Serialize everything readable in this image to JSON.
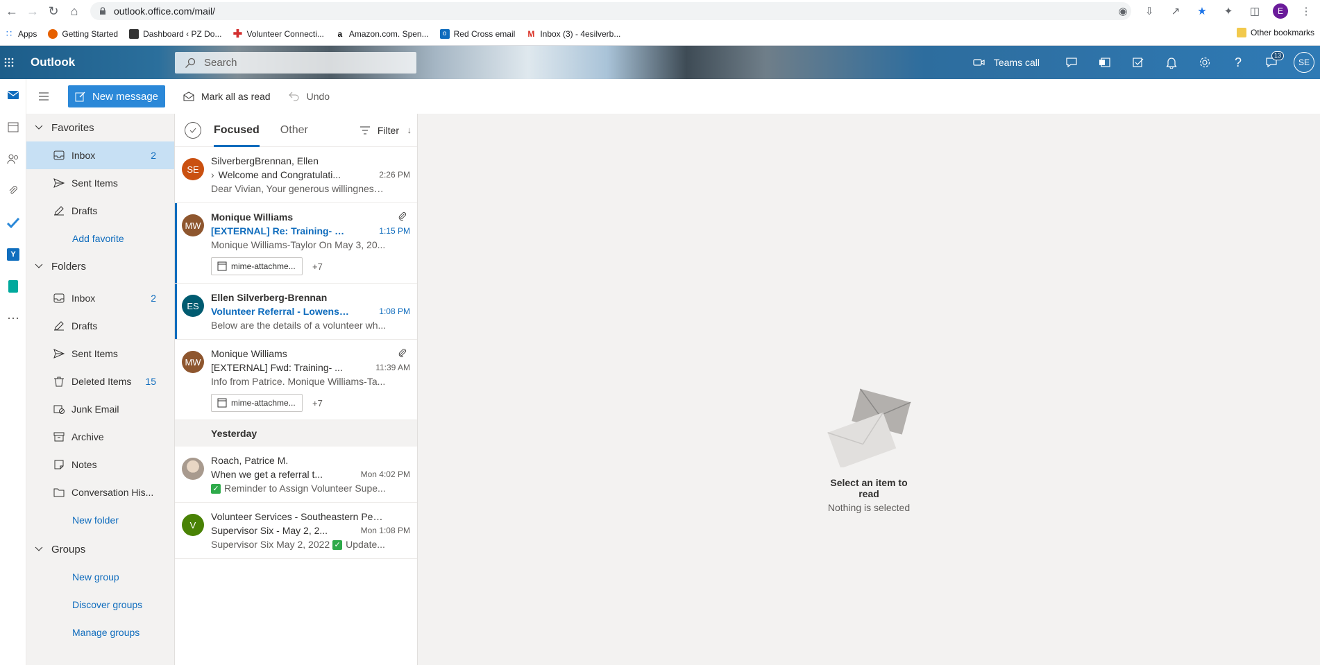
{
  "browser": {
    "url": "outlook.office.com/mail/",
    "bookmarks": [
      "Apps",
      "Getting Started",
      "Dashboard ‹ PZ Do...",
      "Volunteer Connecti...",
      "Amazon.com. Spen...",
      "Red Cross email",
      "Inbox (3) - 4esilverb..."
    ],
    "other_bookmarks": "Other bookmarks",
    "profile_initial": "E"
  },
  "header": {
    "app_name": "Outlook",
    "search_placeholder": "Search",
    "teams_call": "Teams call",
    "notification_count": "13",
    "user_initials": "SE"
  },
  "commands": {
    "new_message": "New message",
    "mark_all_read": "Mark all as read",
    "undo": "Undo"
  },
  "folders": {
    "favorites_label": "Favorites",
    "favorites": [
      {
        "label": "Inbox",
        "count": "2",
        "icon": "inbox-icon"
      },
      {
        "label": "Sent Items",
        "count": "",
        "icon": "send-icon"
      },
      {
        "label": "Drafts",
        "count": "",
        "icon": "pencil-icon"
      }
    ],
    "add_favorite": "Add favorite",
    "folders_label": "Folders",
    "items": [
      {
        "label": "Inbox",
        "count": "2"
      },
      {
        "label": "Drafts",
        "count": ""
      },
      {
        "label": "Sent Items",
        "count": ""
      },
      {
        "label": "Deleted Items",
        "count": "15"
      },
      {
        "label": "Junk Email",
        "count": ""
      },
      {
        "label": "Archive",
        "count": ""
      },
      {
        "label": "Notes",
        "count": ""
      },
      {
        "label": "Conversation His...",
        "count": ""
      }
    ],
    "new_folder": "New folder",
    "groups_label": "Groups",
    "new_group": "New group",
    "discover_groups": "Discover groups",
    "manage_groups": "Manage groups"
  },
  "message_list": {
    "tab_focused": "Focused",
    "tab_other": "Other",
    "filter": "Filter",
    "yesterday_label": "Yesterday",
    "messages": [
      {
        "initials": "SE",
        "color": "#ca5010",
        "sender": "SilverbergBrennan, Ellen",
        "subject": "Welcome and Congratulati...",
        "time": "2:26 PM",
        "preview": "Dear Vivian, Your generous willingness ..."
      },
      {
        "initials": "MW",
        "color": "#8e562e",
        "sender": "Monique Williams",
        "subject": "[EXTERNAL] Re: Training- On...",
        "time": "1:15 PM",
        "preview": "Monique Williams-Taylor On May 3, 20...",
        "attachment": "mime-attachme...",
        "more": "+7"
      },
      {
        "initials": "ES",
        "color": "#005b70",
        "sender": "Ellen Silverberg-Brennan",
        "subject": "Volunteer Referral - Lowenst...",
        "time": "1:08 PM",
        "preview": "Below are the details of a volunteer wh..."
      },
      {
        "initials": "MW",
        "color": "#8e562e",
        "sender": "Monique Williams",
        "subject": "[EXTERNAL] Fwd: Training- ...",
        "time": "11:39 AM",
        "preview": "Info from Patrice. Monique Williams-Ta...",
        "attachment": "mime-attachme...",
        "more": "+7"
      },
      {
        "initials": "",
        "color": "#a89a8e",
        "sender": "Roach, Patrice M.",
        "subject": "When we get a referral t...",
        "time": "Mon 4:02 PM",
        "preview": "Reminder to Assign Volunteer Supe..."
      },
      {
        "initials": "V",
        "color": "#498205",
        "sender": "Volunteer Services - Southeastern Penn...",
        "subject": "Supervisor Six - May 2, 2...",
        "time": "Mon 1:08 PM",
        "preview": "Supervisor Six May 2, 2022",
        "preview_tail": "Update..."
      }
    ]
  },
  "reading_pane": {
    "title": "Select an item to read",
    "subtitle": "Nothing is selected"
  }
}
